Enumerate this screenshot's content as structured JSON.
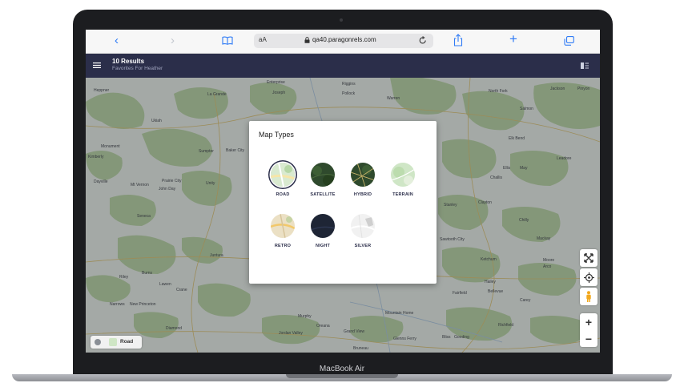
{
  "device": {
    "label": "MacBook Air"
  },
  "browser": {
    "back": "‹",
    "forward": "›",
    "bookmarks_icon": "book-icon",
    "aa_label": "aA",
    "url": "qa40.paragonrels.com",
    "reload_icon": "reload-icon",
    "share_icon": "share-icon",
    "new_tab": "+",
    "tabs_icon": "tabs-icon"
  },
  "header": {
    "title": "10 Results",
    "subtitle": "Favorites For Heather"
  },
  "map": {
    "places": [
      "Heppner",
      "La Grande",
      "Enterprise",
      "Joseph",
      "Riggins",
      "Pollock",
      "Warren",
      "North Fork",
      "Jackson",
      "Pinyon",
      "Ukiah",
      "Salmon",
      "Sumpter",
      "Baker City",
      "Elk Bend",
      "Monument",
      "Kimberly",
      "Leadore",
      "Challis",
      "Dayville",
      "Mt Vernon",
      "Prairie City",
      "John Day",
      "Unity",
      "Ellis",
      "May",
      "Stanley",
      "Clayton",
      "Seneca",
      "Chilly",
      "Juntura",
      "Sawtooth City",
      "Mackay",
      "Riley",
      "Burns",
      "Ketchum",
      "Moore",
      "Arco",
      "Lawen",
      "Crane",
      "Hailey",
      "Fairfield",
      "Bellevue",
      "Carey",
      "Narrows",
      "New Princeton",
      "Mountain Home",
      "Murphy",
      "Oreana",
      "Grand View",
      "Richfield",
      "Diamond",
      "Jordan Valley",
      "Glenns Ferry",
      "Bliss",
      "Gooding",
      "Bruneau"
    ],
    "layer_label": "Road"
  },
  "modal": {
    "title": "Map Types",
    "types": [
      {
        "label": "ROAD",
        "selected": true
      },
      {
        "label": "SATELLITE",
        "selected": false
      },
      {
        "label": "HYBRID",
        "selected": false
      },
      {
        "label": "TERRAIN",
        "selected": false
      },
      {
        "label": "RETRO",
        "selected": false
      },
      {
        "label": "NIGHT",
        "selected": false
      },
      {
        "label": "SILVER",
        "selected": false
      }
    ]
  },
  "controls": {
    "zoom_in": "+",
    "zoom_out": "−"
  },
  "colors": {
    "header": "#2b2e4a",
    "accent": "#2f7bf6",
    "forest": "#b8d3a9"
  }
}
